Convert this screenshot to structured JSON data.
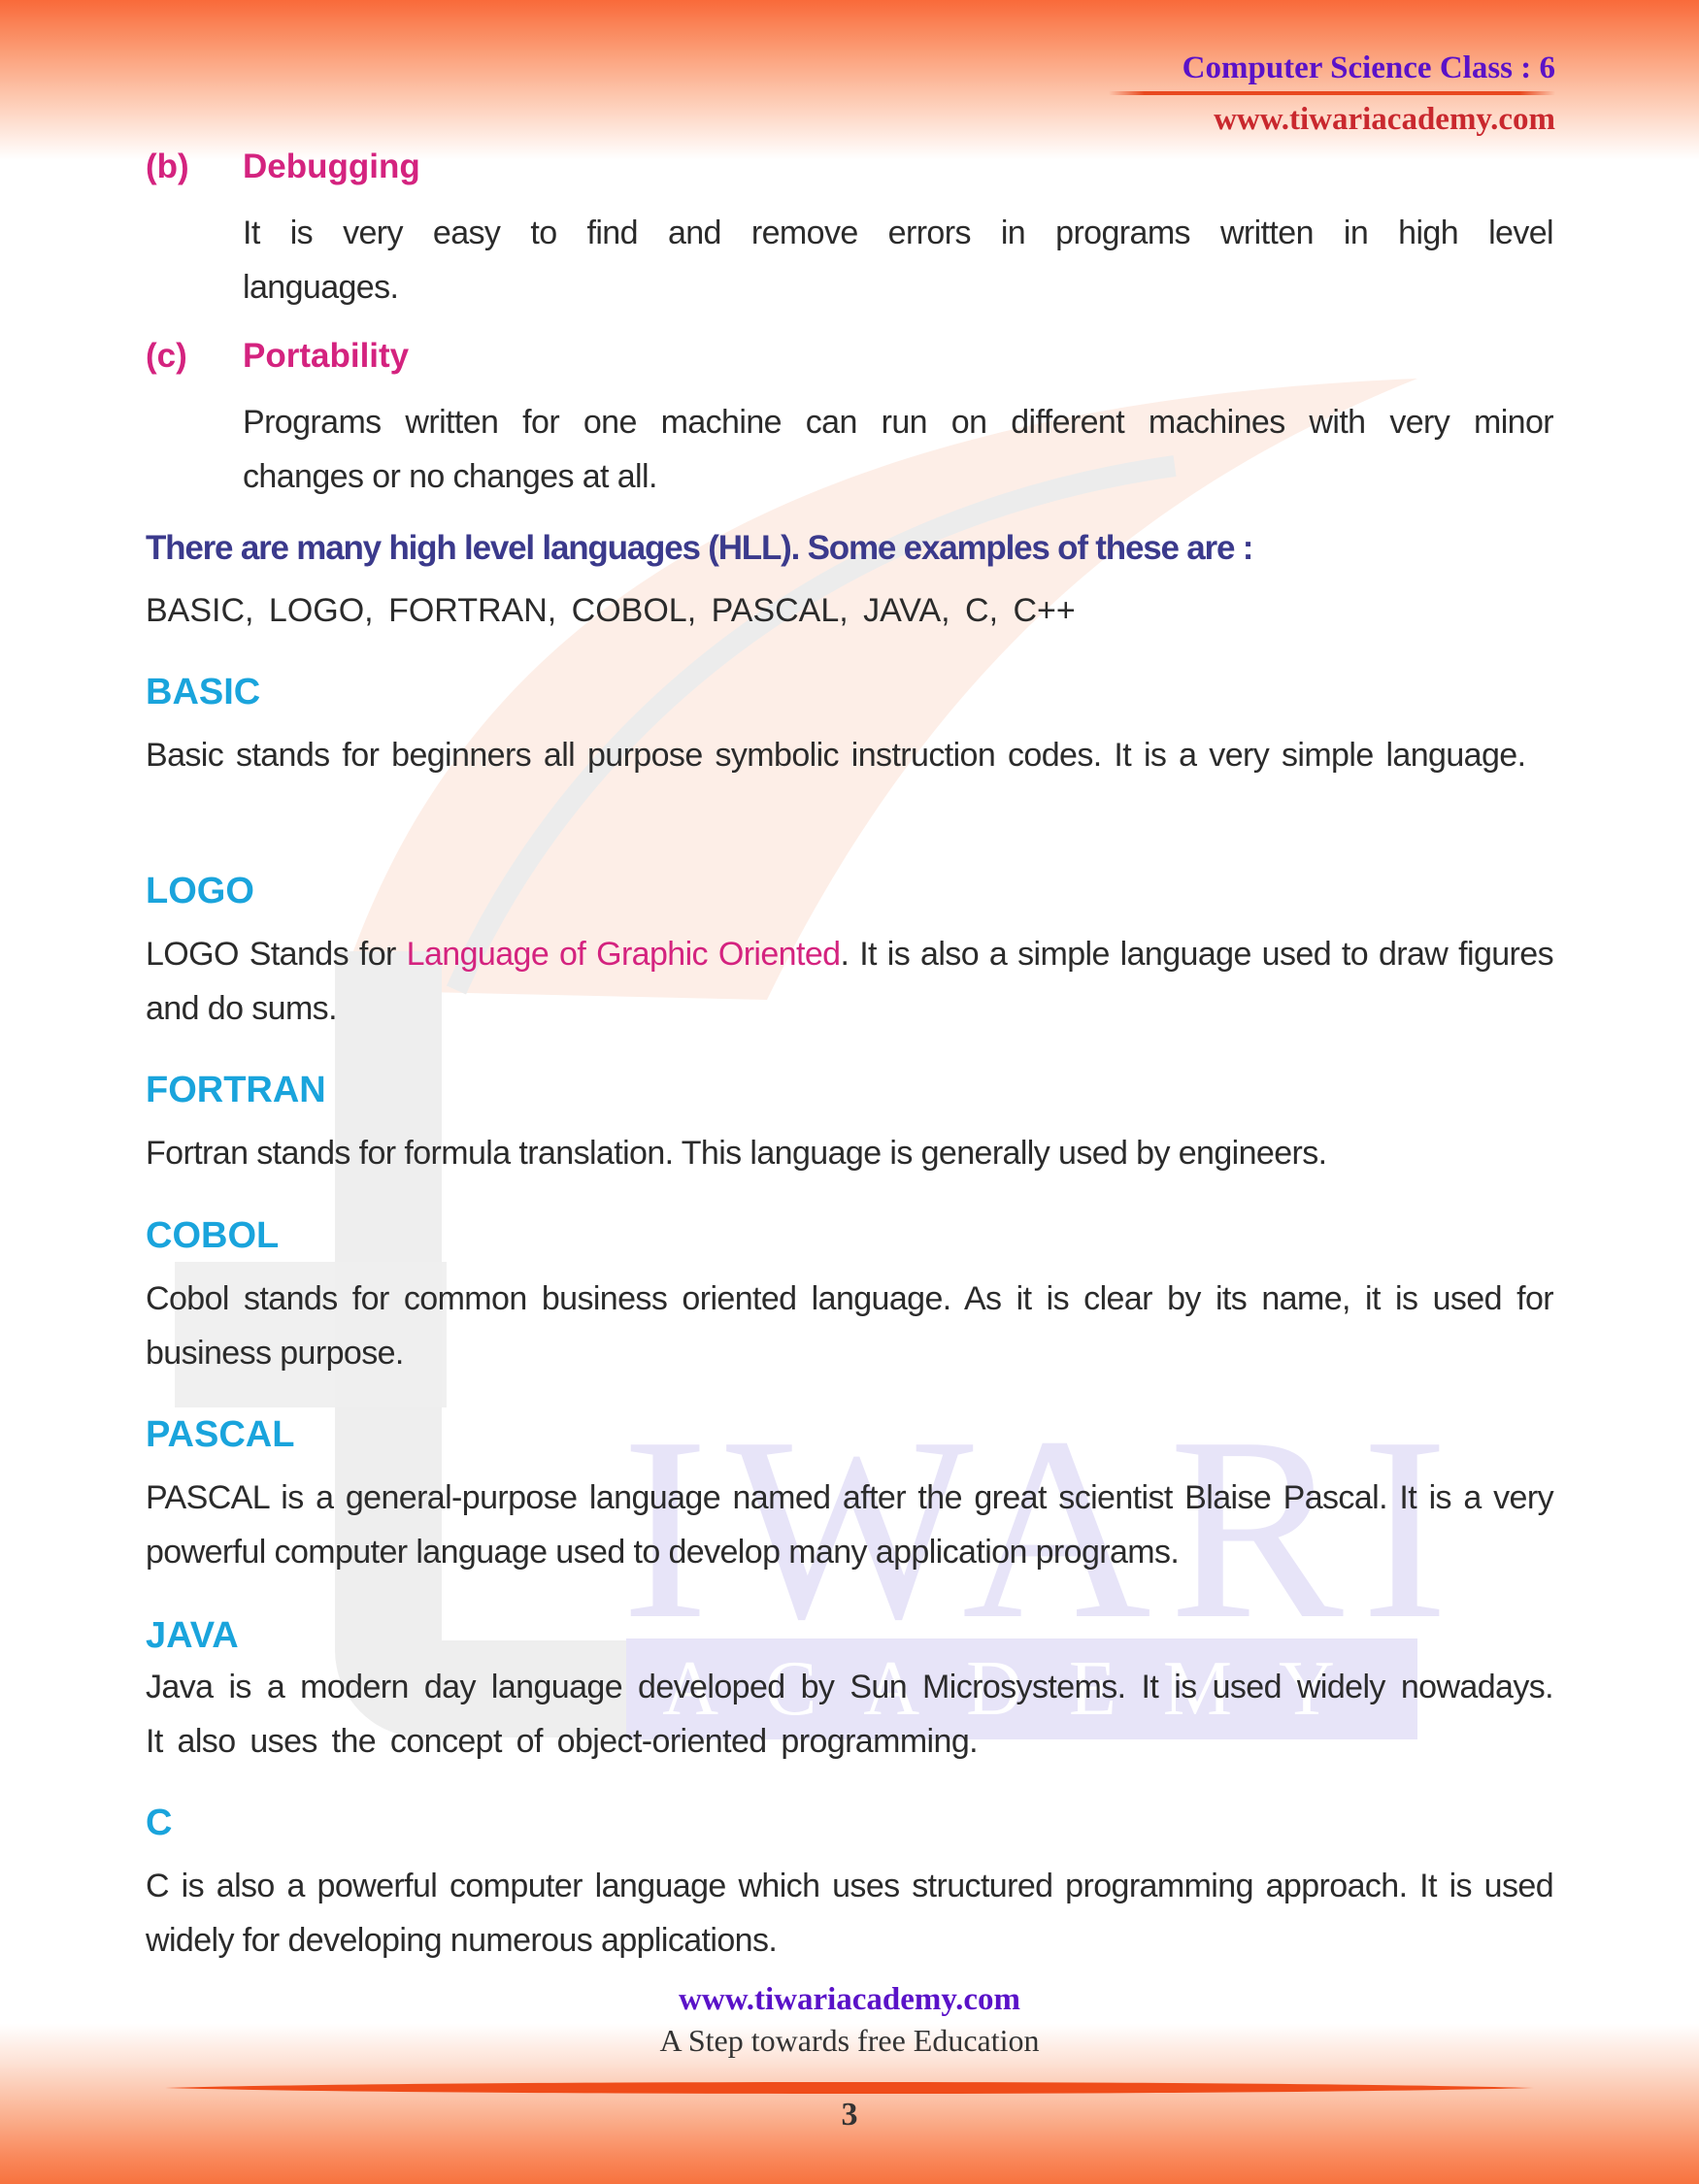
{
  "header": {
    "title": "Computer Science Class : 6",
    "url": "www.tiwariacademy.com"
  },
  "advantages": [
    {
      "label": "(b)",
      "title": "Debugging",
      "body_lines": [
        "It is very easy to find and remove errors in programs written in high level",
        "languages."
      ]
    },
    {
      "label": "(c)",
      "title": "Portability",
      "body_lines": [
        "Programs written for one machine can run on different machines with very minor",
        "changes or no changes at all."
      ]
    }
  ],
  "intro": {
    "text": "There are many high level languages (HLL). Some examples of these are :",
    "list": "BASIC,  LOGO,  FORTRAN,  COBOL, PASCAL, JAVA,  C,  C++"
  },
  "languages": [
    {
      "heading": "BASIC",
      "body": "Basic stands for beginners all purpose symbolic instruction codes. It is a very simple language."
    },
    {
      "heading": "LOGO",
      "body_prefix": "LOGO Stands for ",
      "body_highlight": "Language of Graphic Oriented",
      "body_suffix": ". It is also a simple language used to draw figures and do sums."
    },
    {
      "heading": "FORTRAN",
      "body": "Fortran stands for formula translation. This language is generally used by engineers."
    },
    {
      "heading": "COBOL",
      "body": "Cobol stands for common business oriented language. As it is clear by its name,  it is used for business purpose."
    },
    {
      "heading": "PASCAL",
      "body": "PASCAL  is a general-purpose language named after the great scientist Blaise Pascal. It is a very powerful computer language used to develop many application programs."
    },
    {
      "heading": "JAVA",
      "body": "Java is a modern day language developed by Sun Microsystems. It is used widely nowadays. It also uses the concept of object-oriented programming."
    },
    {
      "heading": "C",
      "body": "C is also a powerful computer language which uses structured programming approach. It is used widely for developing numerous applications."
    }
  ],
  "watermark": {
    "word1": "IWARI",
    "word2": "ACADEMY"
  },
  "footer": {
    "url": "www.tiwariacademy.com",
    "tagline": "A Step towards free Education",
    "page_number": "3"
  },
  "colors": {
    "header_title": "#5a12c8",
    "header_url": "#c9282e",
    "subheading_pink": "#d4237f",
    "intro_navy": "#3b3a8c",
    "language_heading_blue": "#1aa4dc",
    "accent_orange": "#e8481e"
  }
}
